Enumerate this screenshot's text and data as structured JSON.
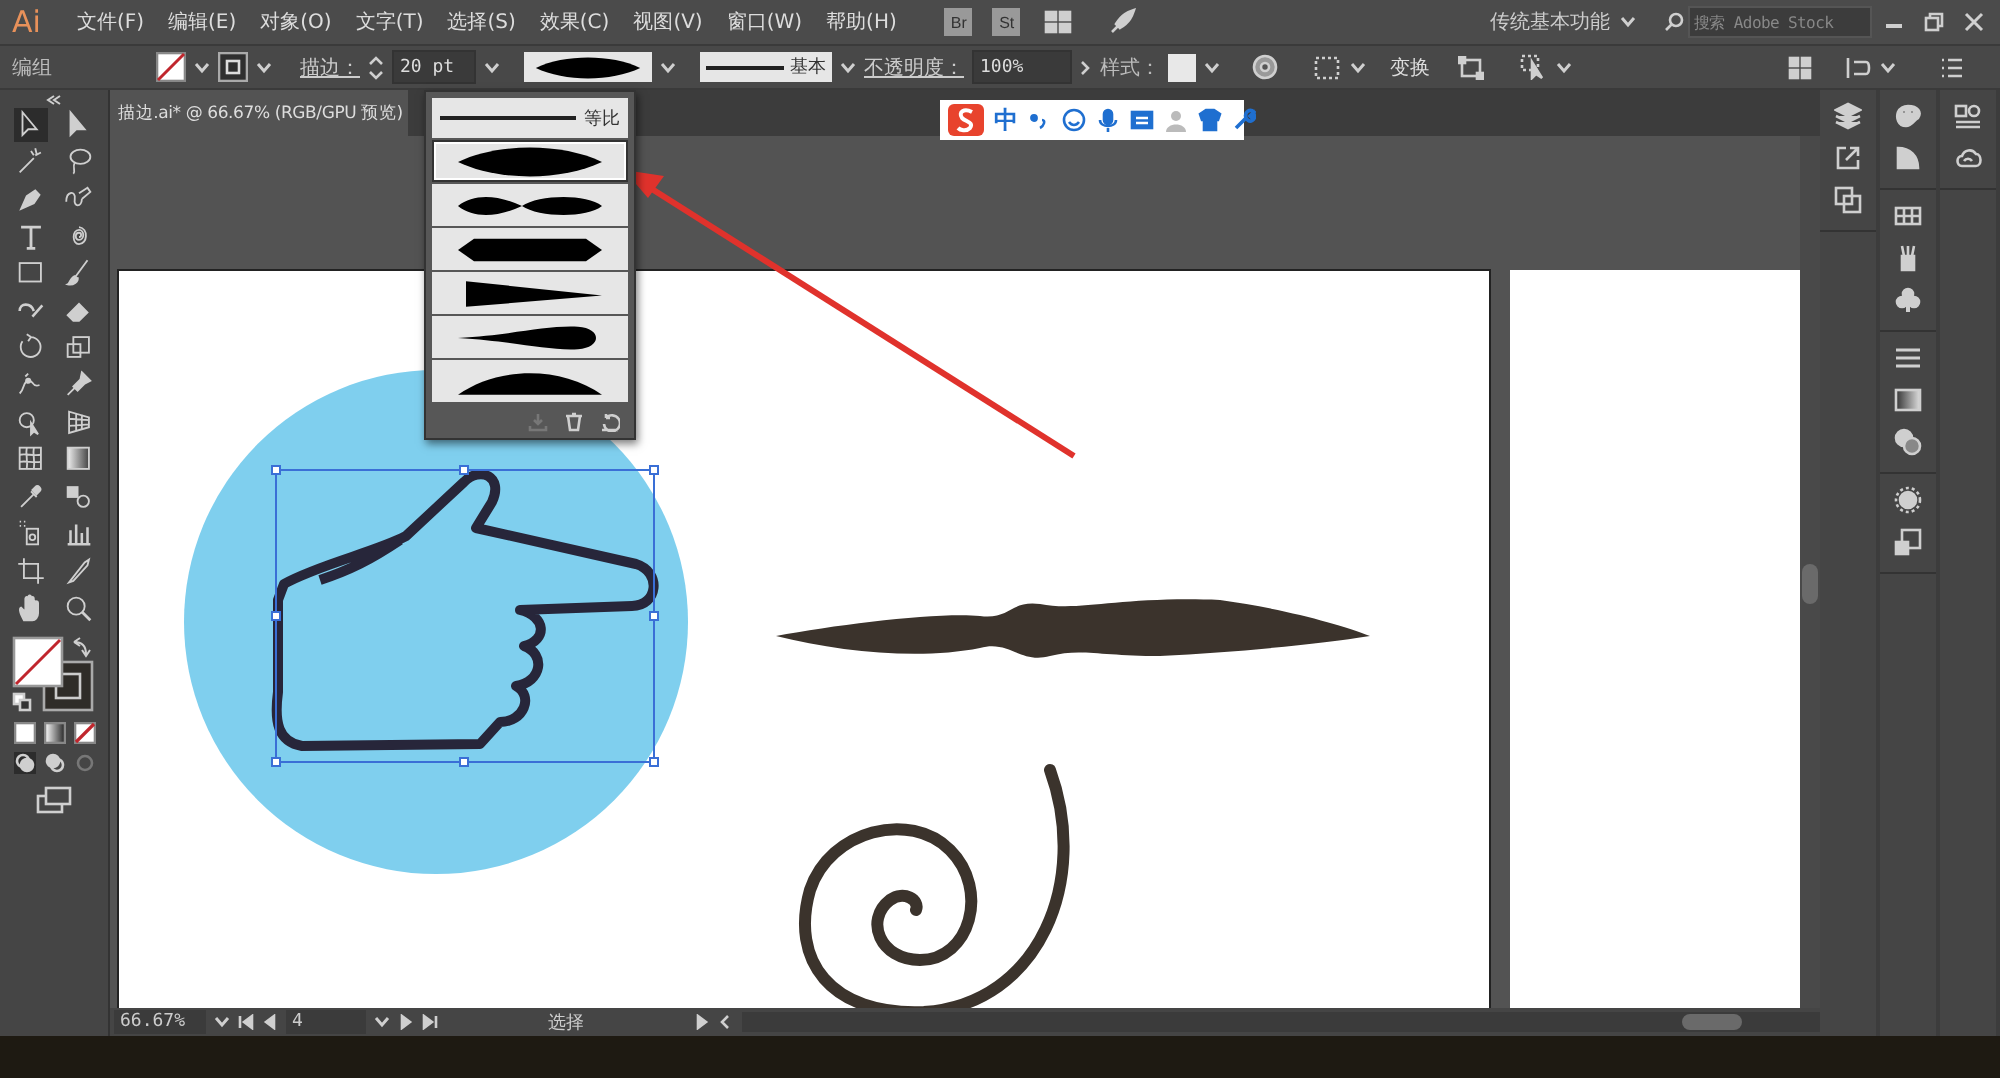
{
  "app": {
    "logo": "Ai"
  },
  "menu": [
    "文件(F)",
    "编辑(E)",
    "对象(O)",
    "文字(T)",
    "选择(S)",
    "效果(C)",
    "视图(V)",
    "窗口(W)",
    "帮助(H)"
  ],
  "app_buttons": [
    "Br",
    "St"
  ],
  "workspace": {
    "label": "传统基本功能"
  },
  "search": {
    "placeholder": "搜索 Adobe Stock"
  },
  "options_bar": {
    "selection_label": "编组",
    "stroke_label": "描边：",
    "stroke_weight": "20 pt",
    "brush_label": "基本",
    "opacity_label": "不透明度：",
    "opacity_value": "100%",
    "style_label": "样式：",
    "transform_label": "变换"
  },
  "document_tab": {
    "title": "描边.ai* @ 66.67% (RGB/GPU 预览)"
  },
  "ime_bar": {
    "mode": "中"
  },
  "width_profiles": {
    "uniform_label": "等比",
    "profiles": [
      {
        "kind": "oval",
        "selected": true
      },
      {
        "kind": "pinch",
        "selected": false
      },
      {
        "kind": "hexagon",
        "selected": false
      },
      {
        "kind": "wedge",
        "selected": false
      },
      {
        "kind": "teardrop",
        "selected": false
      },
      {
        "kind": "arc",
        "selected": false
      }
    ]
  },
  "status_bar": {
    "zoom": "66.67%",
    "artboard": "4",
    "tool": "选择"
  }
}
